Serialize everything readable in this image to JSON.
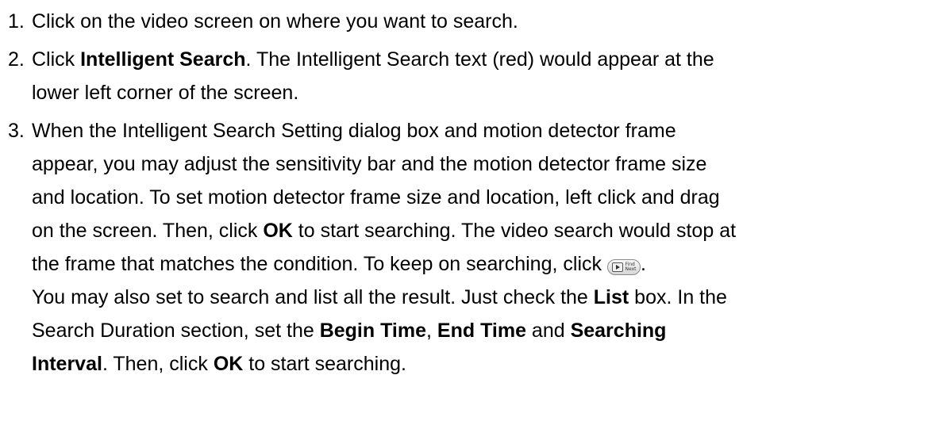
{
  "steps": [
    {
      "number": "1.",
      "lines": [
        [
          "Click on the video screen on where you want to search."
        ]
      ]
    },
    {
      "number": "2.",
      "line1_pre": "Click ",
      "line1_bold": "Intelligent Search",
      "line1_post": ". The Intelligent Search text (red) would appear at the",
      "line2": "lower left corner of the screen."
    },
    {
      "number": "3.",
      "line1": "When the Intelligent Search Setting dialog box and motion detector frame",
      "line2": "appear, you may adjust the sensitivity bar and the motion detector frame size",
      "line3": "and location. To set motion detector frame size and location, left click and drag",
      "line4_pre": "on the screen. Then, click ",
      "line4_bold": "OK",
      "line4_post": " to start searching. The video search would stop at",
      "line5_pre": "the frame that matches the condition. To keep on searching, click ",
      "line5_post": ".",
      "find_next_icon_label": "Find Next",
      "line6_pre": "You may also set to search and list all the result. Just check the ",
      "line6_bold": "List",
      "line6_post": " box. In the",
      "line7_pre": "Search Duration section, set the ",
      "line7_bold1": "Begin Time",
      "line7_mid": ", ",
      "line7_bold2": "End Time",
      "line7_mid2": " and ",
      "line7_bold3": "Searching",
      "line8_bold": "Interval",
      "line8_mid": ". Then, click ",
      "line8_bold2": "OK",
      "line8_post": " to start searching."
    }
  ]
}
